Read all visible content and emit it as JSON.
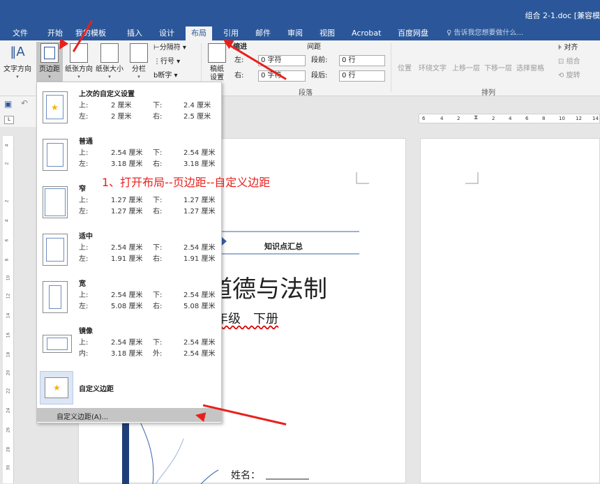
{
  "window": {
    "title": "组合 2-1.doc [兼容模"
  },
  "tabs": [
    "文件",
    "开始",
    "我的模板",
    "插入",
    "设计",
    "布局",
    "引用",
    "邮件",
    "审阅",
    "视图",
    "Acrobat",
    "百度网盘"
  ],
  "tell_me": "告诉我您想要做什么...",
  "ribbon": {
    "text_direction": "文字方向",
    "margins": "页边距",
    "orientation": "纸张方向",
    "size": "纸张大小",
    "columns": "分栏",
    "breaks": "分隔符",
    "line_numbers": "行号",
    "hyphenation": "断字",
    "draft": "稿纸",
    "draft2": "设置",
    "indent_title": "缩进",
    "spacing_title": "间距",
    "indent_left_label": "左:",
    "indent_left_value": "0 字符",
    "indent_right_label": "右:",
    "indent_right_value": "0 字符",
    "space_before_label": "段前:",
    "space_before_value": "0 行",
    "space_after_label": "段后:",
    "space_after_value": "0 行",
    "paragraph_group": "段落",
    "arrange_group": "排列",
    "position": "位置",
    "wrap_text": "环绕文字",
    "bring_forward": "上移一层",
    "send_backward": "下移一层",
    "selection_pane": "选择窗格",
    "align": "对齐",
    "group": "组合",
    "rotate": "旋转"
  },
  "margins_menu": {
    "items": [
      {
        "name": "上次的自定义设置",
        "r1": [
          "上:",
          "2 厘米",
          "下:",
          "2.4 厘米"
        ],
        "r2": [
          "左:",
          "2 厘米",
          "右:",
          "2.5 厘米"
        ]
      },
      {
        "name": "普通",
        "r1": [
          "上:",
          "2.54 厘米",
          "下:",
          "2.54 厘米"
        ],
        "r2": [
          "左:",
          "3.18 厘米",
          "右:",
          "3.18 厘米"
        ]
      },
      {
        "name": "窄",
        "r1": [
          "上:",
          "1.27 厘米",
          "下:",
          "1.27 厘米"
        ],
        "r2": [
          "左:",
          "1.27 厘米",
          "右:",
          "1.27 厘米"
        ]
      },
      {
        "name": "适中",
        "r1": [
          "上:",
          "2.54 厘米",
          "下:",
          "2.54 厘米"
        ],
        "r2": [
          "左:",
          "1.91 厘米",
          "右:",
          "1.91 厘米"
        ]
      },
      {
        "name": "宽",
        "r1": [
          "上:",
          "2.54 厘米",
          "下:",
          "2.54 厘米"
        ],
        "r2": [
          "左:",
          "5.08 厘米",
          "右:",
          "5.08 厘米"
        ]
      },
      {
        "name": "镜像",
        "r1": [
          "上:",
          "2.54 厘米",
          "下:",
          "2.54 厘米"
        ],
        "r2": [
          "内:",
          "3.18 厘米",
          "外:",
          "2.54 厘米"
        ]
      }
    ],
    "custom_label": "自定义边距",
    "custom_margins_button": "自定义边距(A)..."
  },
  "annotation": "1、打开布局--页边距--自定义边距",
  "document": {
    "header": "知识点汇总",
    "title": "道德与法制",
    "subtitle": "年级　下册",
    "name_label": "姓名："
  },
  "ruler": {
    "vertical": [
      "4",
      "2",
      "2",
      "4",
      "6",
      "8",
      "10",
      "12",
      "14",
      "16",
      "18",
      "20",
      "22",
      "24",
      "26",
      "28",
      "30"
    ],
    "horizontal": [
      "6",
      "4",
      "2",
      "2",
      "4",
      "6",
      "8",
      "10",
      "12",
      "14"
    ]
  },
  "colors": {
    "accent": "#2b579a",
    "annotation": "#e8201c"
  }
}
